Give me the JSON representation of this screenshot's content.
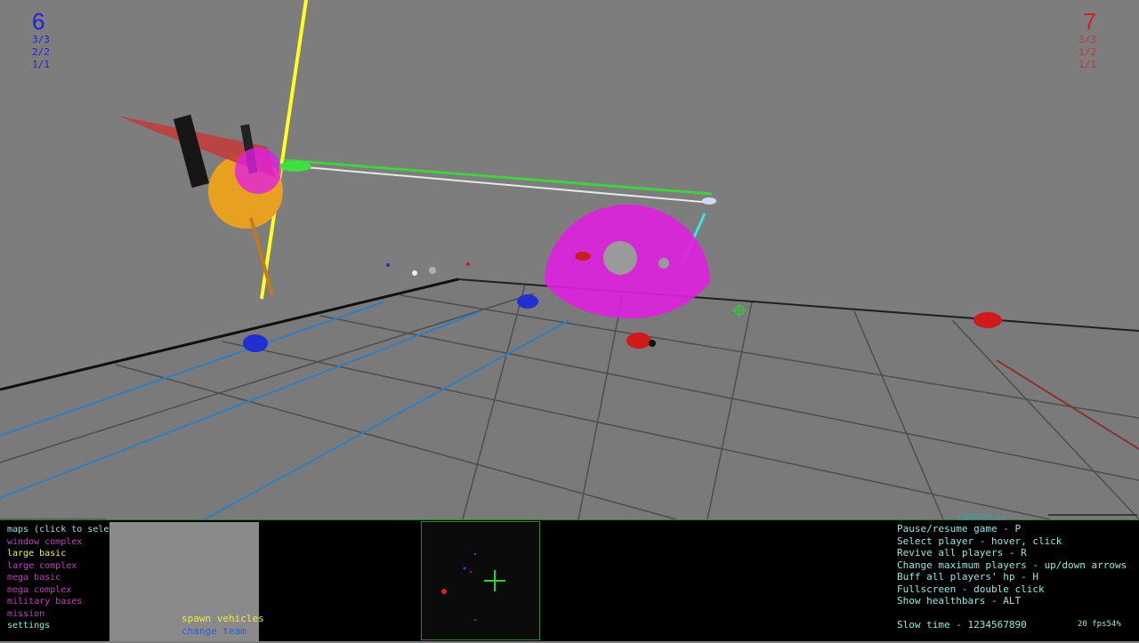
{
  "scores": {
    "blue": {
      "total": "6",
      "lines": [
        "3/3",
        "2/2",
        "1/1"
      ]
    },
    "red": {
      "total": "7",
      "lines": [
        "3/3",
        "1/2",
        "1/1"
      ]
    }
  },
  "maps": {
    "header": "maps (click to select)",
    "items": [
      {
        "label": "window complex",
        "color": "#c23fc2"
      },
      {
        "label": "large basic",
        "color": "#f0f060"
      },
      {
        "label": "large complex",
        "color": "#c23fc2"
      },
      {
        "label": "mega basic",
        "color": "#c23fc2"
      },
      {
        "label": "mega complex",
        "color": "#c23fc2"
      },
      {
        "label": "military bases",
        "color": "#c23fc2"
      },
      {
        "label": "mission",
        "color": "#c23fc2"
      },
      {
        "label": "settings",
        "color": "#8fe7e3"
      }
    ],
    "selected": "large basic"
  },
  "buttons": {
    "spawn": "spawn vehicles",
    "team": "change team"
  },
  "controls": {
    "title": "CONTROLS:",
    "lines": [
      "Pause/resume game - P",
      "Select player - hover, click",
      "Revive all players - R",
      "Change maximum players - up/down arrows",
      "Buff all players' hp - H",
      "Fullscreen - double click",
      "Show healthbars - ALT"
    ],
    "slow_time": "Slow time - 1234567890",
    "fps": "20 fps54%"
  },
  "colors": {
    "blue_team": "#1f1fe0",
    "red_team": "#d81e1e",
    "shield": "#e020e0",
    "laser_yellow": "#ffff20",
    "laser_green": "#40e040",
    "panel_text": "#8fe7e3"
  }
}
